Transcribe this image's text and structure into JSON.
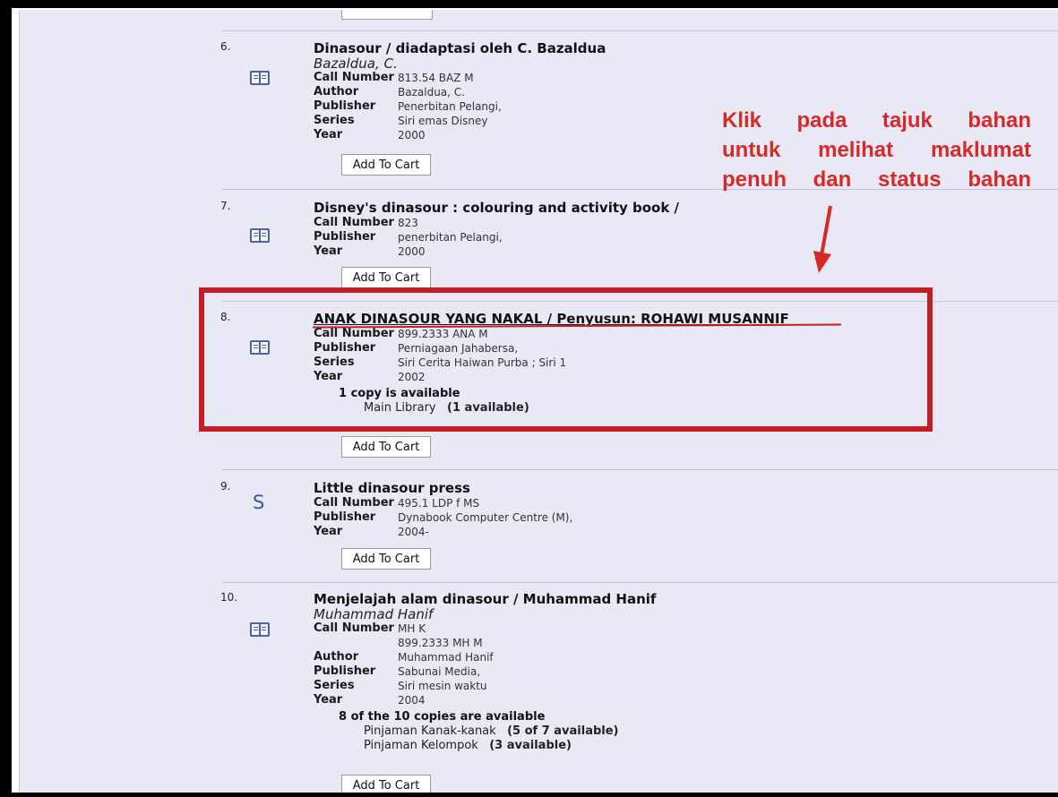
{
  "add_to_cart_label": "Add To Cart",
  "annotation": {
    "line1": "Klik pada tajuk bahan",
    "line2": "untuk melihat maklumat",
    "line3": "penuh dan status bahan",
    "color": "#d62a28"
  },
  "highlight_color": "#c21e24",
  "records": [
    {
      "number": "6.",
      "icon": "book-icon",
      "title": "Dinasour / diadaptasi oleh C. Bazaldua",
      "author_line": "Bazaldua, C.",
      "fields": [
        {
          "label": "Call Number",
          "value": "813.54 BAZ M"
        },
        {
          "label": "Author",
          "value": "Bazaldua, C."
        },
        {
          "label": "Publisher",
          "value": "Penerbitan Pelangi,"
        },
        {
          "label": "Series",
          "value": "Siri emas Disney"
        },
        {
          "label": "Year",
          "value": "2000"
        }
      ]
    },
    {
      "number": "7.",
      "icon": "book-icon",
      "title": "Disney's dinasour : colouring and activity book /",
      "fields": [
        {
          "label": "Call Number",
          "value": "823"
        },
        {
          "label": "Publisher",
          "value": "penerbitan Pelangi,"
        },
        {
          "label": "Year",
          "value": "2000"
        }
      ]
    },
    {
      "number": "8.",
      "icon": "book-icon",
      "title": "ANAK DINASOUR YANG NAKAL / Penyusun: ROHAWI MUSANNIF",
      "fields": [
        {
          "label": "Call Number",
          "value": "899.2333 ANA M"
        },
        {
          "label": "Publisher",
          "value": "Perniagaan Jahabersa,"
        },
        {
          "label": "Series",
          "value": "Siri Cerita Haiwan Purba ; Siri 1"
        },
        {
          "label": "Year",
          "value": "2002"
        }
      ],
      "availability": "1 copy is available",
      "locations": [
        {
          "name": "Main Library",
          "count": "(1 available)"
        }
      ]
    },
    {
      "number": "9.",
      "icon": "serial-icon",
      "icon_glyph": "S",
      "title": "Little dinasour press",
      "fields": [
        {
          "label": "Call Number",
          "value": "495.1 LDP f MS"
        },
        {
          "label": "Publisher",
          "value": "Dynabook Computer Centre (M),"
        },
        {
          "label": "Year",
          "value": "2004-"
        }
      ]
    },
    {
      "number": "10.",
      "icon": "book-icon",
      "title": "Menjelajah alam dinasour / Muhammad Hanif",
      "author_line": "Muhammad Hanif",
      "fields": [
        {
          "label": "Call Number",
          "value": "MH K"
        },
        {
          "label": "",
          "value": "899.2333 MH M"
        },
        {
          "label": "Author",
          "value": "Muhammad Hanif"
        },
        {
          "label": "Publisher",
          "value": "Sabunai Media,"
        },
        {
          "label": "Series",
          "value": "Siri mesin waktu"
        },
        {
          "label": "Year",
          "value": "2004"
        }
      ],
      "availability": "8 of the 10 copies are available",
      "locations": [
        {
          "name": "Pinjaman Kanak-kanak",
          "count": "(5 of 7 available)"
        },
        {
          "name": "Pinjaman Kelompok",
          "count": "(3 available)"
        }
      ]
    }
  ]
}
